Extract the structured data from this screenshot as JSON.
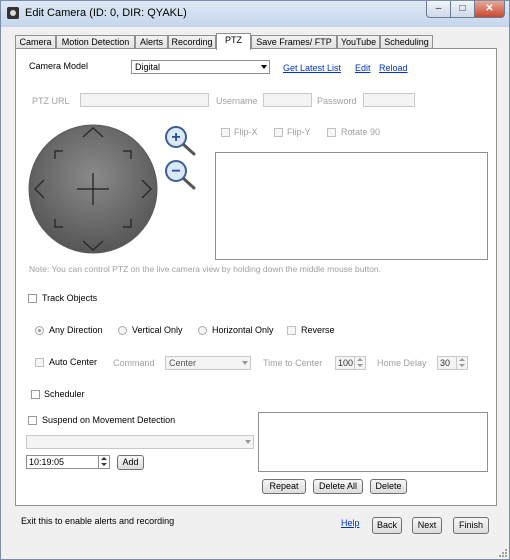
{
  "window": {
    "title": "Edit Camera (ID: 0, DIR: QYAKL)",
    "controls": [
      "–",
      "□",
      "✕"
    ]
  },
  "tabs": [
    {
      "label": "Camera"
    },
    {
      "label": "Motion Detection"
    },
    {
      "label": "Alerts"
    },
    {
      "label": "Recording"
    },
    {
      "label": "PTZ",
      "active": true
    },
    {
      "label": "Save Frames/ FTP"
    },
    {
      "label": "YouTube"
    },
    {
      "label": "Scheduling"
    }
  ],
  "ptz": {
    "camera_model_label": "Camera Model",
    "camera_model_value": "Digital",
    "get_latest_list": "Get Latest List",
    "edit": "Edit",
    "reload": "Reload",
    "ptz_url_label": "PTZ URL",
    "username_label": "Username",
    "password_label": "Password",
    "flip_x": "Flip-X",
    "flip_y": "Flip-Y",
    "rotate_90": "Rotate 90",
    "zoom_in": "+",
    "zoom_out": "−",
    "note": "Note: You can control PTZ on the live camera view by holding down the middle mouse button.",
    "track_objects": "Track Objects",
    "any_direction": "Any Direction",
    "vertical_only": "Vertical Only",
    "horizontal_only": "Horizontal Only",
    "reverse": "Reverse",
    "auto_center": "Auto Center",
    "command_label": "Command",
    "command_value": "Center",
    "time_to_center_label": "Time to Center",
    "time_to_center_value": "100",
    "home_delay_label": "Home Delay",
    "home_delay_value": "30",
    "scheduler": "Scheduler",
    "suspend_on_movement": "Suspend on Movement Detection",
    "time_value": "10:19:05",
    "add": "Add",
    "repeat": "Repeat",
    "delete_all": "Delete All",
    "delete": "Delete"
  },
  "footer": {
    "status": "Exit this to enable alerts and recording",
    "help": "Help",
    "back": "Back",
    "next": "Next",
    "finish": "Finish"
  }
}
